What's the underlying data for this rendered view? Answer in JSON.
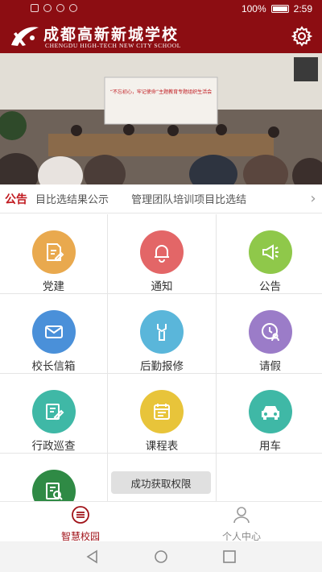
{
  "status_bar": {
    "battery": "100%",
    "time": "2:59"
  },
  "header": {
    "school_name_cn": "成都高新新城学校",
    "school_name_en": "CHENGDU HIGH-TECH NEW CITY SCHOOL",
    "logo_icon": "school-logo-icon",
    "settings_icon": "gear-icon",
    "color": "#8c0d12"
  },
  "banner": {
    "banner_text": "“不忘初心，牢记使命”主题教育专题组织生活会"
  },
  "notice": {
    "label": "公告",
    "items": [
      "目比选结果公示",
      "管理团队培训项目比选结"
    ],
    "arrow_icon": "chevron-right-icon"
  },
  "grid": {
    "items": [
      {
        "label": "党建",
        "icon": "document-edit-icon",
        "color": "#e9a94e"
      },
      {
        "label": "通知",
        "icon": "bell-icon",
        "color": "#e36667"
      },
      {
        "label": "公告",
        "icon": "megaphone-icon",
        "color": "#8fc84a"
      },
      {
        "label": "校长信箱",
        "icon": "mail-icon",
        "color": "#4a90d9"
      },
      {
        "label": "后勤报修",
        "icon": "wrench-icon",
        "color": "#5ab6da"
      },
      {
        "label": "请假",
        "icon": "clock-person-icon",
        "color": "#9b7cc8"
      },
      {
        "label": "行政巡查",
        "icon": "inspect-edit-icon",
        "color": "#3fb8a6"
      },
      {
        "label": "课程表",
        "icon": "schedule-icon",
        "color": "#e8c43a"
      },
      {
        "label": "用车",
        "icon": "car-icon",
        "color": "#3fb8a6"
      },
      {
        "label": "",
        "icon": "document-search-icon",
        "color": "#2f8a45"
      }
    ]
  },
  "toast": "成功获取权限",
  "bottom_nav": {
    "items": [
      {
        "label": "智慧校园",
        "icon": "campus-list-icon",
        "active": true
      },
      {
        "label": "个人中心",
        "icon": "person-icon",
        "active": false
      }
    ],
    "active_color": "#a01218"
  },
  "system_nav": {
    "back_icon": "back-triangle-icon",
    "home_icon": "home-circle-icon",
    "recents_icon": "recents-square-icon"
  }
}
